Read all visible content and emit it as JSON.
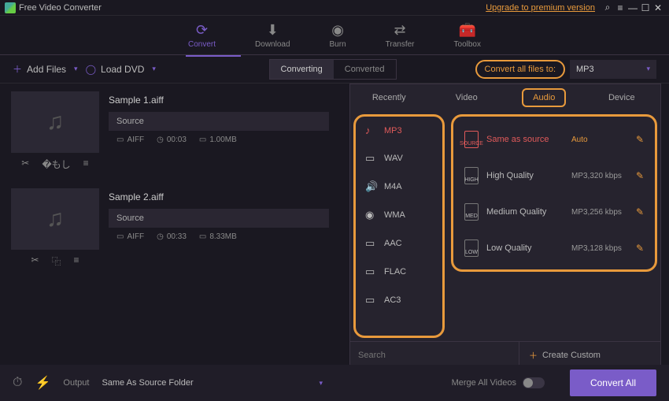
{
  "app": {
    "title": "Free Video Converter",
    "upgrade": "Upgrade to premium version"
  },
  "nav": [
    {
      "label": "Convert",
      "icon": "⟳"
    },
    {
      "label": "Download",
      "icon": "⬇"
    },
    {
      "label": "Burn",
      "icon": "◉"
    },
    {
      "label": "Transfer",
      "icon": "⇄"
    },
    {
      "label": "Toolbox",
      "icon": "🧰"
    }
  ],
  "toolbar": {
    "add_files": "Add Files",
    "load_dvd": "Load DVD",
    "tab_converting": "Converting",
    "tab_converted": "Converted",
    "convert_all_label": "Convert all files to:",
    "convert_all_value": "MP3"
  },
  "files": [
    {
      "name": "Sample 1.aiff",
      "source": "Source",
      "fmt": "AIFF",
      "dur": "00:03",
      "size": "1.00MB"
    },
    {
      "name": "Sample 2.aiff",
      "source": "Source",
      "fmt": "AIFF",
      "dur": "00:33",
      "size": "8.33MB"
    }
  ],
  "flyout": {
    "tabs": [
      "Recently",
      "Video",
      "Audio",
      "Device"
    ],
    "active_tab": 2,
    "formats": [
      "MP3",
      "WAV",
      "M4A",
      "WMA",
      "AAC",
      "FLAC",
      "AC3"
    ],
    "active_format": 0,
    "qualities": [
      {
        "name": "Same as source",
        "detail": "Auto",
        "badge": "SOURCE"
      },
      {
        "name": "High Quality",
        "detail": "MP3,320 kbps",
        "badge": "HIGH"
      },
      {
        "name": "Medium Quality",
        "detail": "MP3,256 kbps",
        "badge": "MED"
      },
      {
        "name": "Low Quality",
        "detail": "MP3,128 kbps",
        "badge": "LOW"
      }
    ],
    "search_placeholder": "Search",
    "create_custom": "Create Custom"
  },
  "footer": {
    "output_label": "Output",
    "output_value": "Same As Source Folder",
    "merge_label": "Merge All Videos",
    "convert_all": "Convert All"
  }
}
